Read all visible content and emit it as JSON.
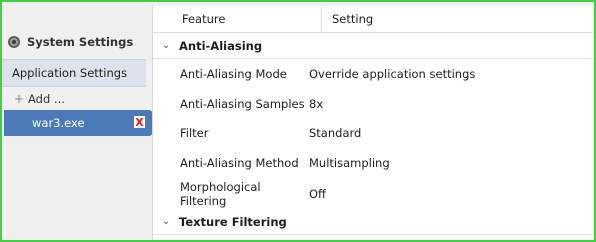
{
  "sidebar": {
    "system_settings": "System Settings",
    "application_settings": "Application Settings",
    "add_label": "Add ...",
    "selected_app": "war3.exe",
    "remove_glyph": "X"
  },
  "table": {
    "col_feature": "Feature",
    "col_setting": "Setting",
    "groups": [
      {
        "name": "Anti-Aliasing",
        "rows": [
          {
            "feature": "Anti-Aliasing Mode",
            "setting": "Override application settings"
          },
          {
            "feature": "Anti-Aliasing Samples",
            "setting": "8x"
          },
          {
            "feature": "Filter",
            "setting": "Standard"
          },
          {
            "feature": "Anti-Aliasing Method",
            "setting": "Multisampling"
          },
          {
            "feature": "Morphological Filtering",
            "setting": "Off"
          }
        ]
      },
      {
        "name": "Texture Filtering",
        "rows": []
      }
    ]
  },
  "colors": {
    "frame_border": "#3ed23e",
    "selection": "#4a7ab8",
    "remove": "#e02020"
  }
}
